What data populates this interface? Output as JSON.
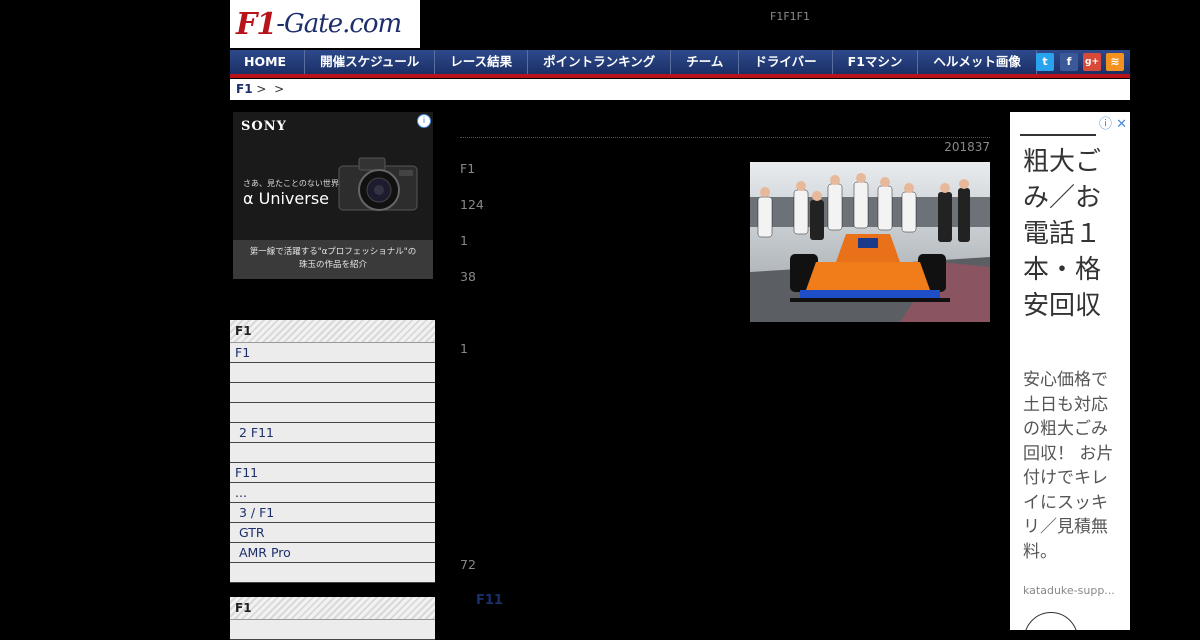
{
  "header": {
    "logo_f1": "F1",
    "logo_rest": "-Gate.com",
    "tagline": "F1F1F1"
  },
  "nav": {
    "items": [
      "HOME",
      "開催スケジュール",
      "レース結果",
      "ポイントランキング",
      "チーム",
      "ドライバー",
      "F1マシン",
      "ヘルメット画像"
    ],
    "social": [
      {
        "name": "twitter-icon",
        "glyph": "t",
        "color": "#2aa3ef"
      },
      {
        "name": "facebook-icon",
        "glyph": "f",
        "color": "#3b5998"
      },
      {
        "name": "google-plus-icon",
        "glyph": "g+",
        "color": "#d84a38"
      },
      {
        "name": "rss-icon",
        "glyph": "≋",
        "color": "#f3921e"
      }
    ]
  },
  "breadcrumb": {
    "home": "F1",
    "sep1": ">",
    "sep2": ">"
  },
  "ad_left": {
    "brand": "SONY",
    "tagline": "さあ、見たことのない世界へ。",
    "alpha": "α Universe",
    "caption_line1": "第一線で活躍する\"αプロフェッショナル\"の",
    "caption_line2": "珠玉の作品を紹介"
  },
  "sidebar": {
    "menu1": {
      "head": "F1",
      "items": [
        "F1",
        "",
        "",
        "",
        " 2 F11",
        "",
        "F11",
        "...",
        " 3 / F1",
        " GTR",
        " AMR Pro",
        ""
      ]
    },
    "menu2": {
      "head": "F1"
    }
  },
  "article": {
    "date": "201837",
    "lines": [
      "F1",
      "124",
      "1",
      "38",
      "1",
      "72"
    ],
    "link": "F11"
  },
  "ad_right": {
    "info_icons": "ⓘ ✕",
    "headline": "粗大ごみ／お電話１本・格安回収",
    "body": "安心価格で土日も対応の粗大ごみ回収！ お片付けでキレイにスッキリ／見積無料。",
    "url": "kataduke-supp..."
  }
}
